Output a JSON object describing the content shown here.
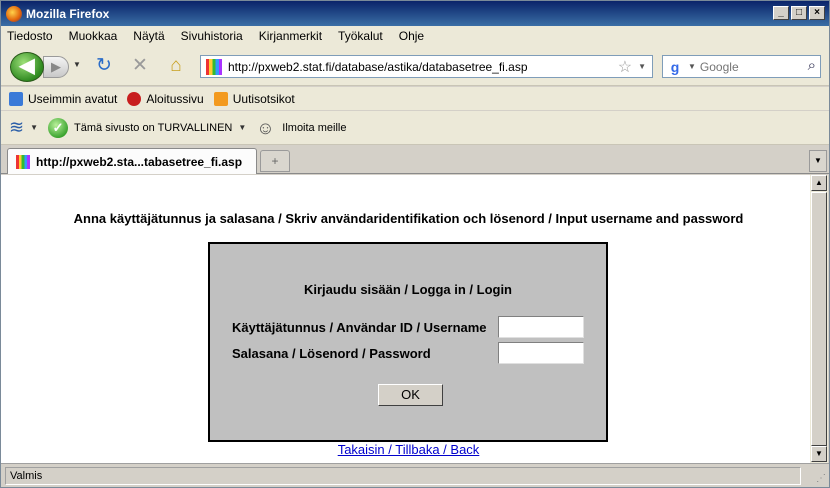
{
  "window": {
    "title": "Mozilla Firefox"
  },
  "menu": [
    "Tiedosto",
    "Muokkaa",
    "Näytä",
    "Sivuhistoria",
    "Kirjanmerkit",
    "Työkalut",
    "Ohje"
  ],
  "nav": {
    "url": "http://pxweb2.stat.fi/database/astika/databasetree_fi.asp",
    "search_placeholder": "Google"
  },
  "bookmarks": [
    "Useimmin avatut",
    "Aloitussivu",
    "Uutisotsikot"
  ],
  "addon": {
    "safe_text": "Tämä sivusto on TURVALLINEN",
    "report_text": "Ilmoita meille"
  },
  "tab": {
    "title": "http://pxweb2.sta...tabasetree_fi.asp"
  },
  "page": {
    "heading": "Anna käyttäjätunnus ja salasana / Skriv användaridentifikation och lösenord / Input username and password",
    "login_title": "Kirjaudu sisään / Logga in / Login",
    "username_label": "Käyttäjätunnus / Användar ID / Username",
    "password_label": "Salasana / Lösenord / Password",
    "username_value": "",
    "password_value": "",
    "ok_label": "OK",
    "back_link": "Takaisin / Tillbaka / Back"
  },
  "status": {
    "text": "Valmis"
  }
}
